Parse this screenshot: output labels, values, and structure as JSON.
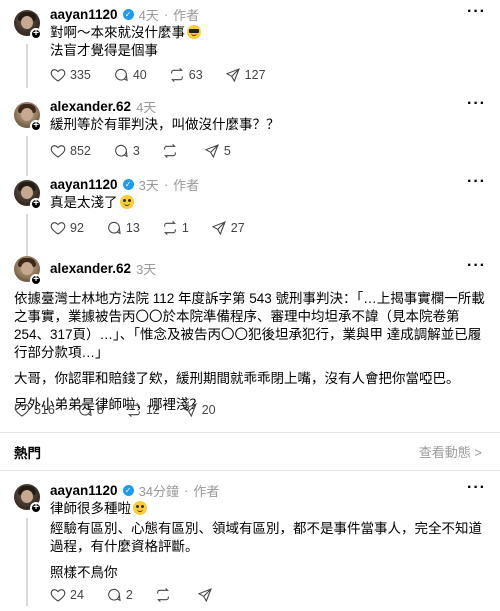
{
  "posts": [
    {
      "username": "aayan1120",
      "time": "4天",
      "author_tag": "作者",
      "lines": [
        "對啊～本來就沒什麼事",
        "法盲才覺得是個事"
      ],
      "emoji": "sunglasses",
      "likes": "335",
      "replies": "40",
      "reposts": "63",
      "shares": "127"
    },
    {
      "username": "alexander.62",
      "time": "4天",
      "lines": [
        "緩刑等於有罪判決，叫做沒什麼事？？"
      ],
      "likes": "852",
      "replies": "3",
      "reposts": "",
      "shares": "5"
    },
    {
      "username": "aayan1120",
      "time": "3天",
      "author_tag": "作者",
      "lines": [
        "真是太淺了"
      ],
      "emoji": "laugh-cry",
      "likes": "92",
      "replies": "13",
      "reposts": "1",
      "shares": "27"
    },
    {
      "username": "alexander.62",
      "time": "3天",
      "paragraphs": [
        "依據臺灣士林地方法院 112 年度訴字第 543 號刑事判決：「…上揭事實欄一所載之事實，業據被告丙〇〇於本院準備程序、審理中均坦承不諱（見本院卷第254、317頁）…」、「惟念及被告丙〇〇犯後坦承犯行，業與甲 達成調解並已履行部分款項…」",
        "大哥，你認罪和賠錢了欸，緩刑期間就乖乖閉上嘴，沒有人會把你當啞巴。",
        "另外小弟弟是律師啦，哪裡淺？"
      ],
      "likes": "516",
      "replies": "8",
      "reposts": "12",
      "shares": "20"
    },
    {
      "username": "aayan1120",
      "time": "34分鐘",
      "author_tag": "作者",
      "lines": [
        "律師很多種啦"
      ],
      "emoji": "sweat",
      "paragraphs": [
        "經驗有區別、心態有區別、領域有區別，都不是事件當事人，完全不知道過程，有什麼資格評斷。",
        "照樣不鳥你"
      ],
      "likes": "24",
      "replies": "2",
      "reposts": "",
      "shares": ""
    }
  ],
  "section": {
    "label": "熱門",
    "view_activity": "查看動態 >"
  },
  "icons": {
    "more": "more-dots-icon",
    "verified": "verified-badge-icon",
    "like": "heart-icon",
    "reply": "comment-icon",
    "repost": "repost-icon",
    "share": "send-icon"
  }
}
